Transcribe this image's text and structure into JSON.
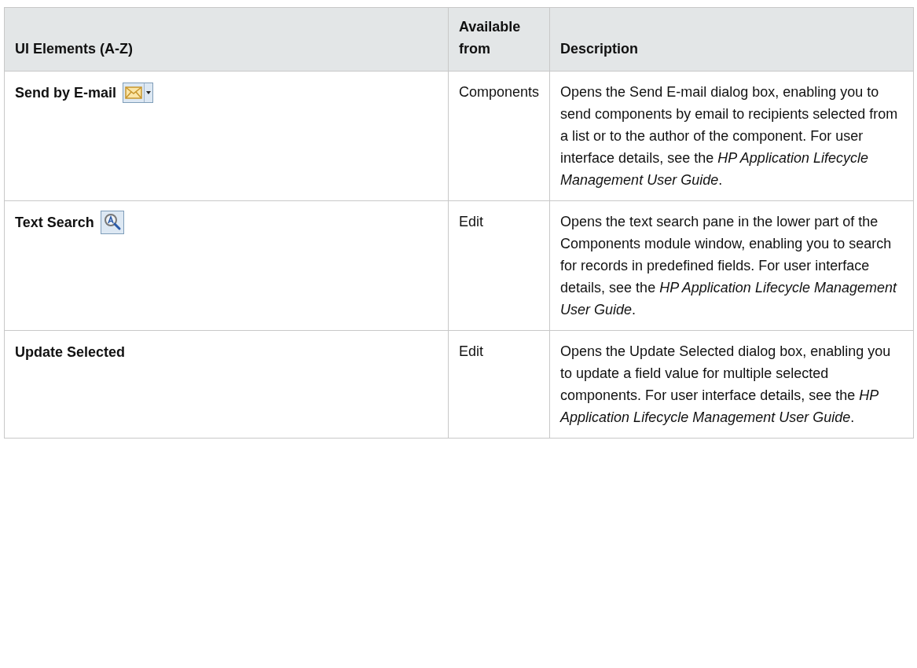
{
  "table": {
    "columns": [
      "UI Elements (A-Z)",
      "Available from",
      "Description"
    ],
    "rows": [
      {
        "element": "Send by E-mail",
        "kind": "envelope",
        "available_from": "Components",
        "description": "Opens the Send E-mail dialog box, enabling you to send components by email to recipients selected from a list or to the author of the component. For user interface details, see the *HP Application Lifecycle Management User Guide*."
      },
      {
        "element": "Text Search",
        "kind": "search",
        "available_from": "Edit",
        "description": "Opens the text search pane in the lower part of the Components module window, enabling you to search for records in predefined fields. For user interface details, see the *HP Application Lifecycle Management User Guide*."
      },
      {
        "element": "Update Selected",
        "kind": "plain",
        "available_from": "Edit",
        "description": "Opens the Update Selected dialog box, enabling you to update a field value for multiple selected components. For user interface details, see the *HP Application Lifecycle Management User Guide*."
      }
    ]
  }
}
